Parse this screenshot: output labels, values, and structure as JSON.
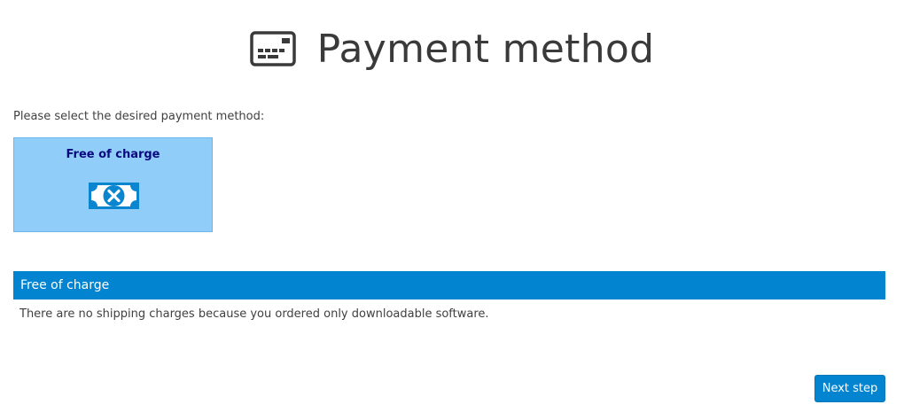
{
  "header": {
    "title": "Payment method",
    "icon": "payment-card-icon"
  },
  "instruction": "Please select the desired payment method:",
  "payment_options": [
    {
      "title": "Free of charge",
      "icon": "cancelled-banknote-icon",
      "selected": true
    }
  ],
  "selected_method": {
    "title": "Free of charge",
    "description": "There are no shipping charges because you ordered only downloadable software."
  },
  "actions": {
    "next_label": "Next step"
  },
  "colors": {
    "accent": "#0384d0",
    "card_background": "#90cdf8",
    "card_title": "#0a0a80",
    "text": "#404040"
  }
}
